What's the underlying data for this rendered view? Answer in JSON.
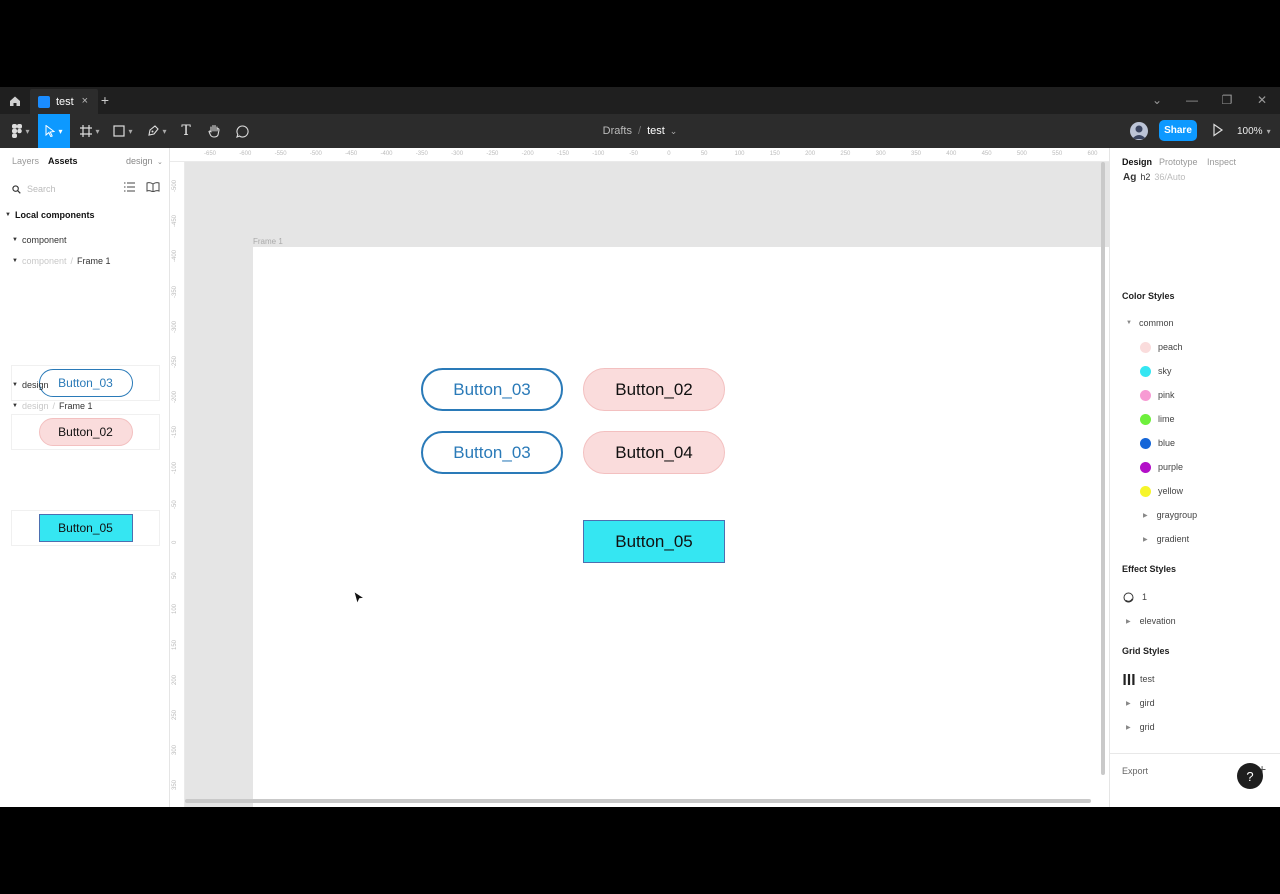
{
  "tabbar": {
    "home_icon": "home-icon",
    "tab_label": "test",
    "tab_close": "×",
    "tab_add": "+",
    "window_controls": [
      "⌄",
      "—",
      "❐",
      "✕"
    ]
  },
  "toolbar": {
    "breadcrumb_parent": "Drafts",
    "breadcrumb_sep": "/",
    "breadcrumb_file": "test",
    "breadcrumb_caret": "⌄",
    "share_label": "Share",
    "zoom": "100%",
    "text_tool_glyph": "T"
  },
  "left_panel": {
    "tabs": [
      "Layers",
      "Assets"
    ],
    "page_select": "design",
    "search_placeholder": "Search",
    "local_components": "Local components",
    "groups": [
      {
        "name": "component",
        "sub_parent": "component",
        "sub_sep": "/",
        "sub_name": "Frame 1",
        "items": [
          "Button_03",
          "Button_02"
        ]
      },
      {
        "name": "design",
        "sub_parent": "design",
        "sub_sep": "/",
        "sub_name": "Frame 1",
        "items": [
          "Button_05"
        ]
      }
    ]
  },
  "canvas": {
    "frame_label": "Frame 1",
    "ruler_top": [
      "-650",
      "-600",
      "-550",
      "-500",
      "-450",
      "-400",
      "-350",
      "-300",
      "-250",
      "-200",
      "-150",
      "-100",
      "-50",
      "0",
      "50",
      "100",
      "150",
      "200",
      "250",
      "300",
      "350",
      "400",
      "450",
      "500",
      "550",
      "600"
    ],
    "ruler_left": [
      "-500",
      "-450",
      "-400",
      "-350",
      "-300",
      "-250",
      "-200",
      "-150",
      "-100",
      "-50",
      "0",
      "50",
      "100",
      "150",
      "200",
      "250",
      "300",
      "350"
    ],
    "buttons": [
      "Button_03",
      "Button_02",
      "Button_03",
      "Button_04",
      "Button_05"
    ]
  },
  "right_panel": {
    "tabs": [
      "Design",
      "Prototype",
      "Inspect"
    ],
    "text_style_preview": "Ag",
    "text_style_name": "h2",
    "text_style_meta": "36/Auto",
    "color_styles_title": "Color Styles",
    "color_group": "common",
    "colors": [
      {
        "name": "peach",
        "hex": "#fadcdc"
      },
      {
        "name": "sky",
        "hex": "#35e6f2"
      },
      {
        "name": "pink",
        "hex": "#f79ad3"
      },
      {
        "name": "lime",
        "hex": "#6ef03c"
      },
      {
        "name": "blue",
        "hex": "#1566d8"
      },
      {
        "name": "purple",
        "hex": "#b30fc8"
      },
      {
        "name": "yellow",
        "hex": "#f6f52a"
      }
    ],
    "color_subgroups": [
      "graygroup",
      "gradient"
    ],
    "effect_styles_title": "Effect Styles",
    "effect_item": "1",
    "effect_group": "elevation",
    "grid_styles_title": "Grid Styles",
    "grid_item": "test",
    "grid_groups": [
      "gird",
      "grid"
    ],
    "export_label": "Export",
    "export_add": "+",
    "help_label": "?"
  }
}
